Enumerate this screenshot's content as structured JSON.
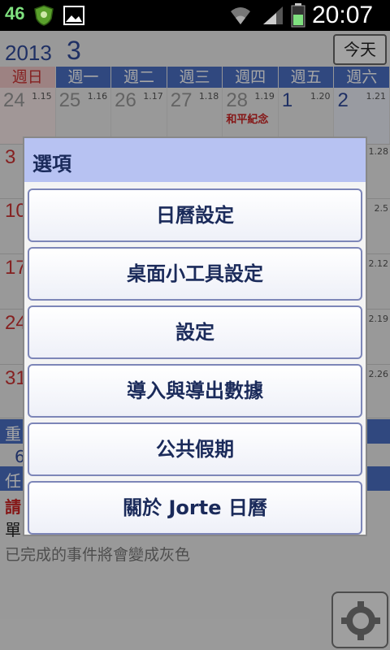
{
  "status_bar": {
    "notification_count": "46",
    "time": "20:07",
    "icons": [
      "shield-icon",
      "image-icon",
      "wifi-icon",
      "signal-icon",
      "battery-icon"
    ],
    "battery_color": "#7fe07f"
  },
  "calendar": {
    "year": "2013",
    "month": "3",
    "today_label": "今天",
    "weekdays": [
      "週日",
      "週一",
      "週二",
      "週三",
      "週四",
      "週五",
      "週六"
    ],
    "first_week": [
      {
        "day": "24",
        "lunar": "1.15"
      },
      {
        "day": "25",
        "lunar": "1.16"
      },
      {
        "day": "26",
        "lunar": "1.17"
      },
      {
        "day": "27",
        "lunar": "1.18"
      },
      {
        "day": "28",
        "lunar": "1.19",
        "holiday": "和平紀念"
      },
      {
        "day": "1",
        "lunar": "1.20"
      },
      {
        "day": "2",
        "lunar": "1.21"
      }
    ],
    "left_days": [
      "3",
      "10",
      "17",
      "24",
      "31"
    ],
    "right_lunar": [
      "1.28",
      "2.5",
      "2.12",
      "2.19",
      "2.26"
    ],
    "sections": {
      "important_fragment": "重",
      "important_value": "6",
      "task_fragment": "任",
      "please_fragment": "請",
      "single_fragment": "單"
    },
    "completed_note": "已完成的事件將會變成灰色",
    "colors": {
      "accent": "#4b6fc4",
      "sunday": "#c33"
    }
  },
  "dialog": {
    "title": "選項",
    "items": [
      {
        "label": "日曆設定"
      },
      {
        "label": "桌面小工具設定"
      },
      {
        "label": "設定"
      },
      {
        "label": "導入與導出數據"
      },
      {
        "label": "公共假期"
      },
      {
        "label": "關於 Jorte 日曆"
      }
    ],
    "title_color": "#b7c2f2"
  }
}
